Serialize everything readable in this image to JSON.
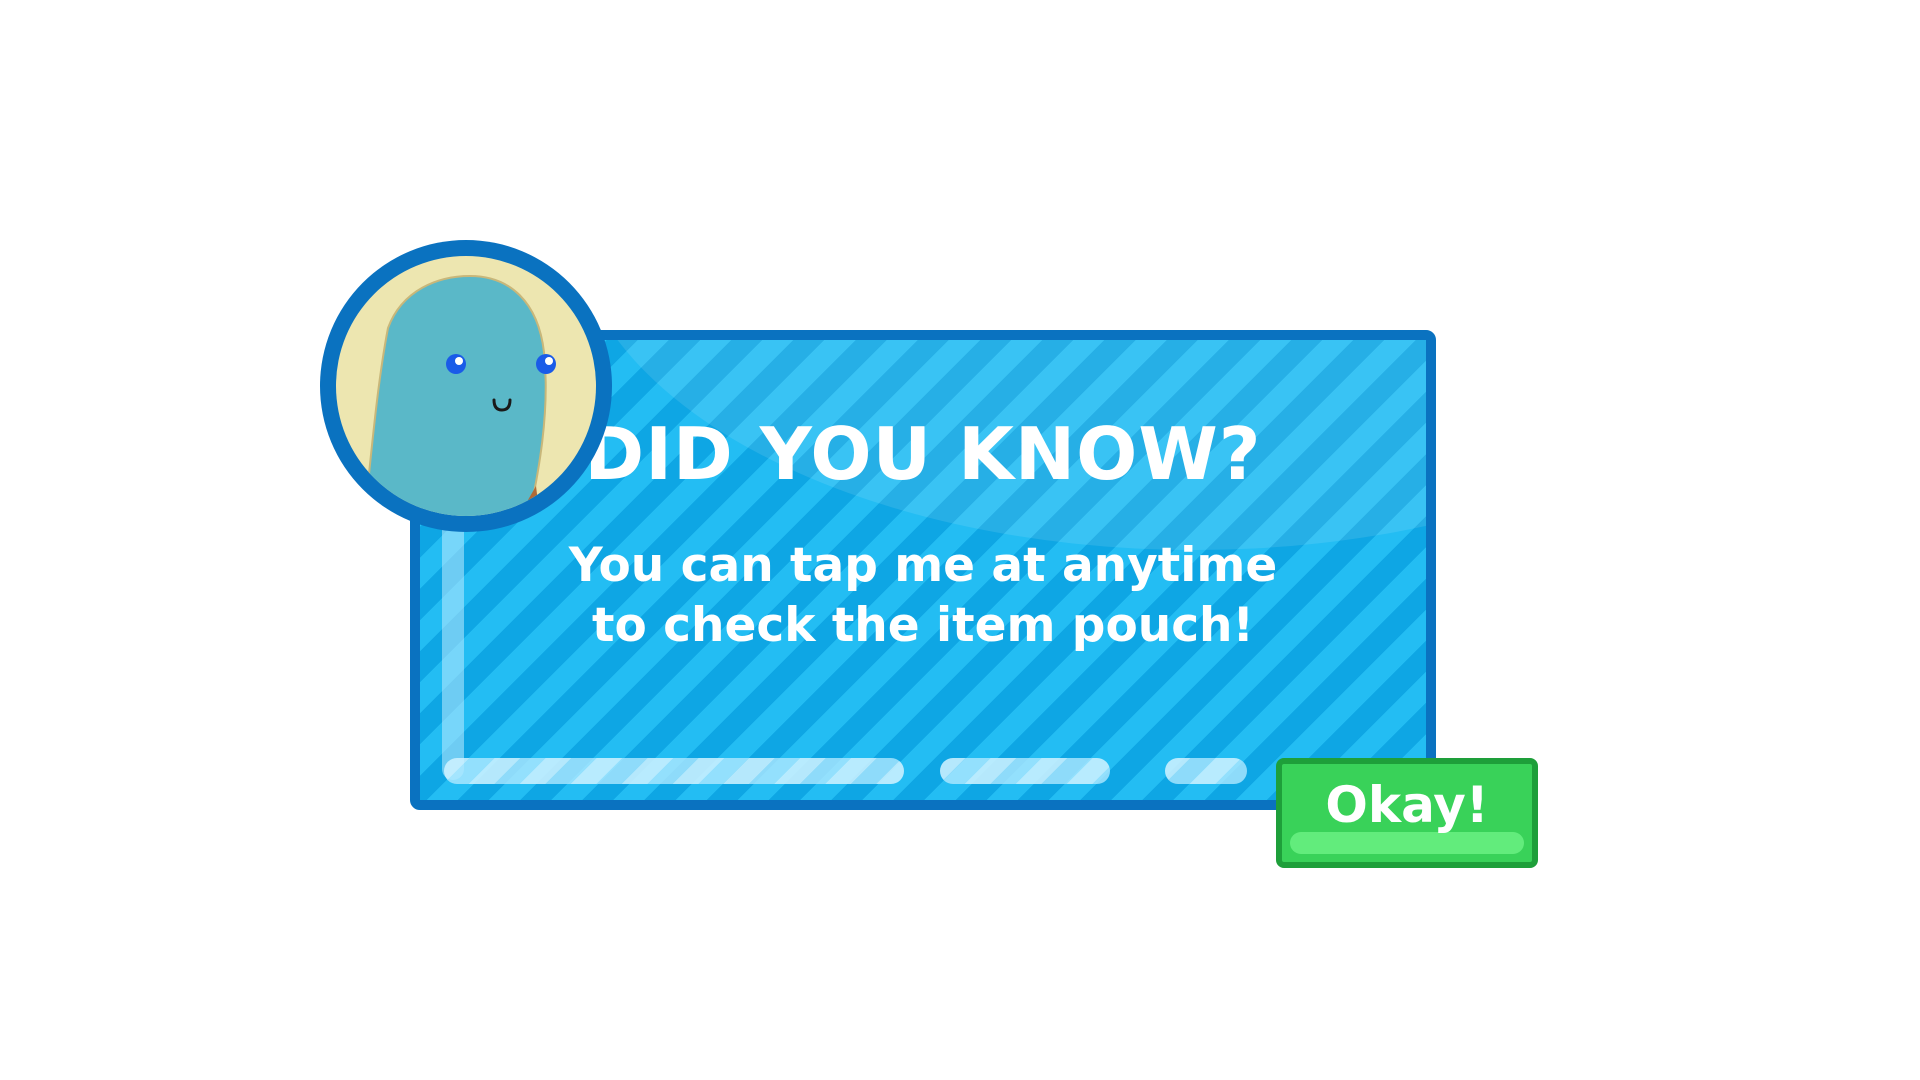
{
  "dialog": {
    "title": "DID YOU KNOW?",
    "message_lines": [
      "You can tap me at anytime",
      "to check the item pouch!"
    ]
  },
  "avatar": {
    "icon": "blob-character-icon"
  },
  "okay_button": {
    "label": "Okay!"
  },
  "colors": {
    "panel_border": "#0a72c0",
    "panel_fill": "#0ea6e4",
    "panel_stripe": "#23bdf3",
    "avatar_background": "#ede6b0",
    "character_body": "#5ab8c8",
    "button_fill": "#39d259",
    "button_border": "#1e9f3a",
    "text": "#ffffff"
  }
}
